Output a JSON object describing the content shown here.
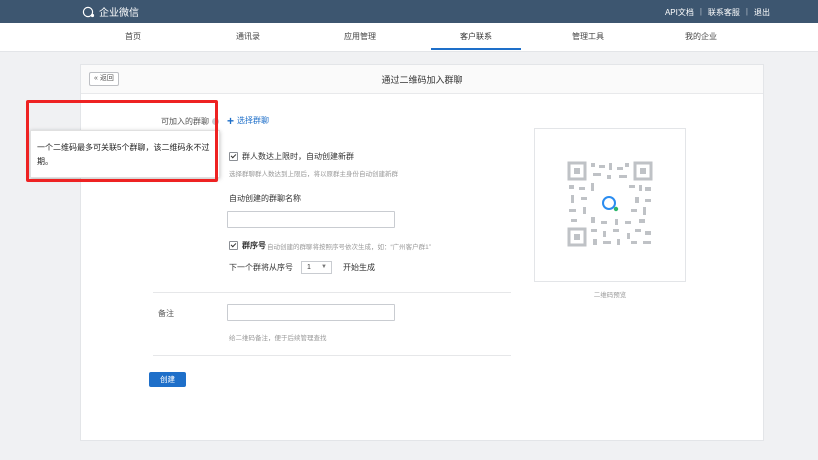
{
  "app": {
    "name": "企业微信"
  },
  "toplinks": {
    "api": "API文档",
    "sep": "|",
    "support": "联系客服",
    "logout": "退出"
  },
  "nav": {
    "home": "首页",
    "contacts": "通讯录",
    "apps": "应用管理",
    "customers": "客户联系",
    "tools": "管理工具",
    "company": "我的企业"
  },
  "page": {
    "back": "« 返回",
    "title": "通过二维码加入群聊"
  },
  "form": {
    "groups_label": "可加入的群聊",
    "add_group": "选择群聊",
    "auto_create_label": "群人数达上限时，自动创建新群",
    "auto_create_hint": "选择群聊群人数达到上限后，将以原群主身份自动创建新群",
    "name_label": "自动创建的群聊名称",
    "name_value": "",
    "serial_label": "群序号",
    "serial_hint": "自动创建的群聊将按照序号依次生成，如：“广州客户群1”",
    "next_prefix": "下一个群将从序号",
    "next_value": "1",
    "next_suffix": "开始生成",
    "remark_label": "备注",
    "remark_value": "",
    "remark_hint": "给二维码备注，便于后续管理查找",
    "create_button": "创建"
  },
  "qr": {
    "caption": "二维码预览"
  },
  "tooltip": {
    "text": "一个二维码最多可关联5个群聊，该二维码永不过期。"
  },
  "colors": {
    "topbar": "#3d5670",
    "accent": "#1e6fc9",
    "highlight": "#ee2222"
  }
}
